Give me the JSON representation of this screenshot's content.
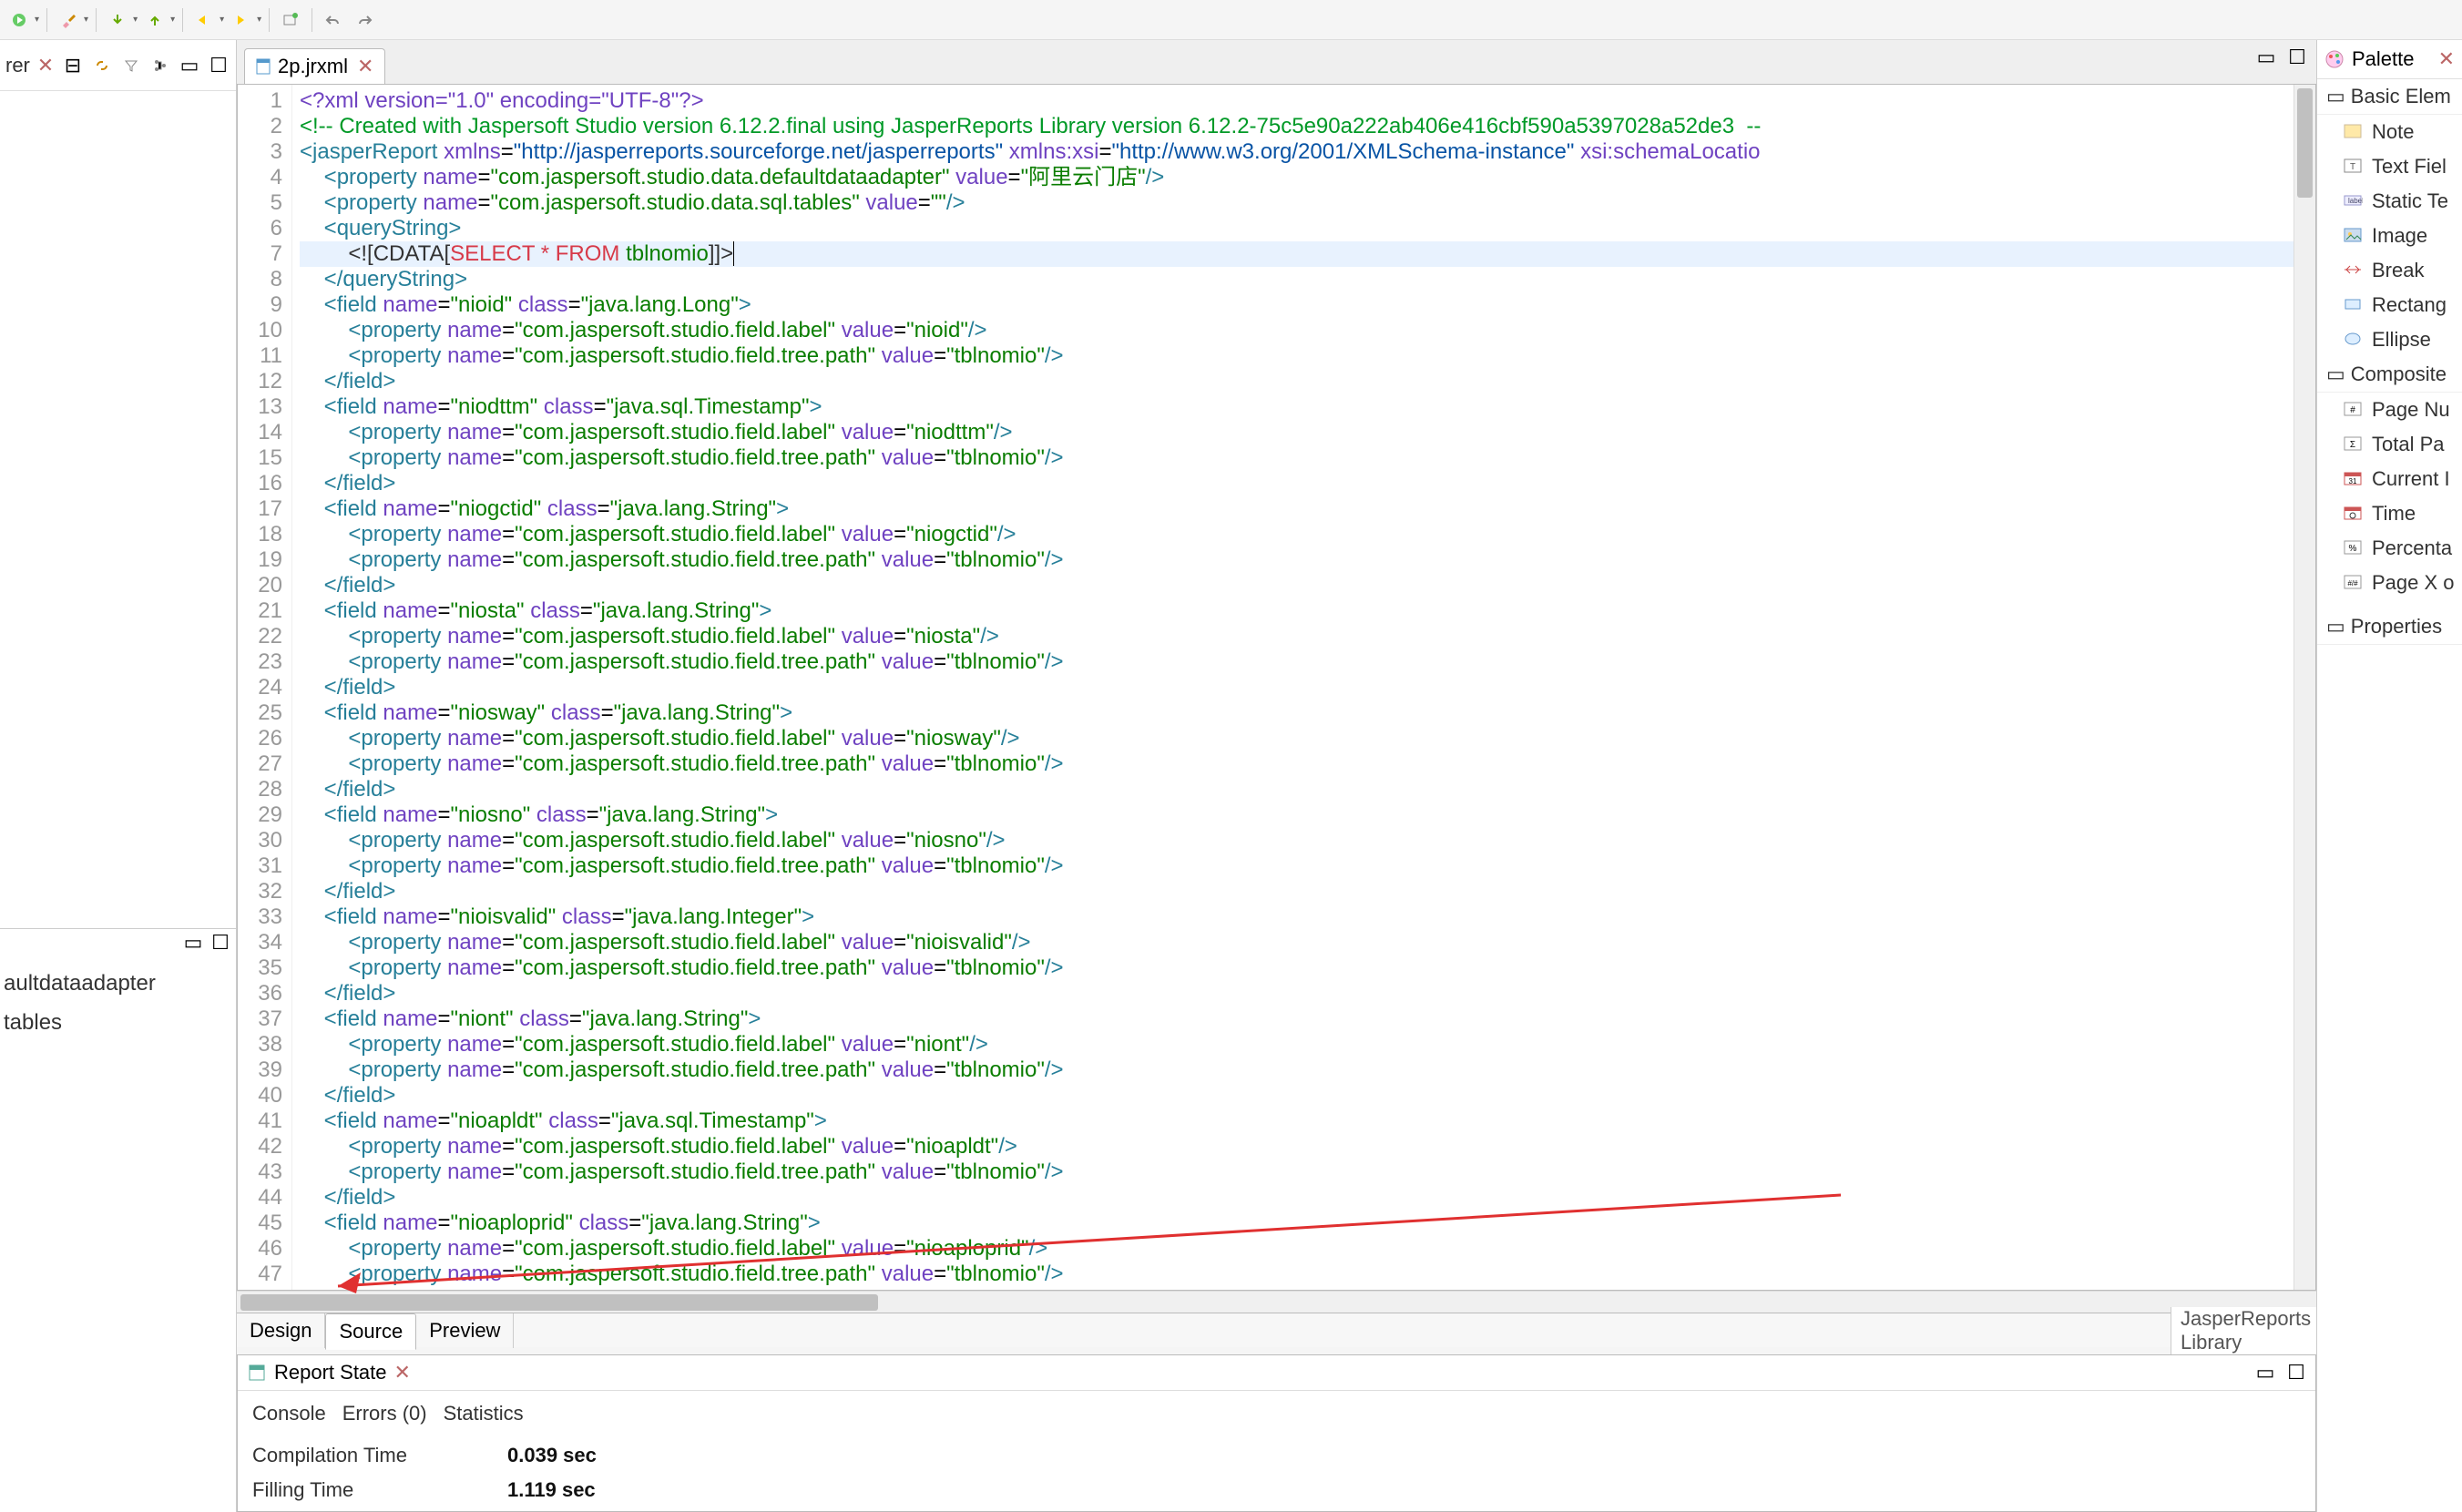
{
  "toolbar": {
    "icons": [
      "run",
      "brush",
      "arrow-down-g",
      "arrow-up-g",
      "back",
      "forward",
      "new-window",
      "refresh-l",
      "refresh-r"
    ]
  },
  "left": {
    "explorer_tab": "rer"
  },
  "left_bottom": {
    "items": [
      "aultdataadapter",
      "tables"
    ]
  },
  "editor": {
    "tab_name": "2p.jrxml",
    "code": [
      {
        "n": 1,
        "html": "<span class='t-pi'>&lt;?xml version=\"1.0\" encoding=\"UTF-8\"?&gt;</span>"
      },
      {
        "n": 2,
        "html": "<span class='t-cm'>&lt;!-- Created with Jaspersoft Studio version 6.12.2.final using JasperReports Library version 6.12.2-75c5e90a222ab406e416cbf590a5397028a52de3  --</span>"
      },
      {
        "n": 3,
        "html": "<span class='t-tag'>&lt;jasperReport</span> <span class='t-attr'>xmlns</span>=<span class='t-url'>\"http://jasperreports.sourceforge.net/jasperreports\"</span> <span class='t-attr'>xmlns:xsi</span>=<span class='t-url'>\"http://www.w3.org/2001/XMLSchema-instance\"</span> <span class='t-attr'>xsi:schemaLocatio</span>"
      },
      {
        "n": 4,
        "html": "    <span class='t-tag'>&lt;property</span> <span class='t-attr'>name</span>=<span class='t-str'>\"com.jaspersoft.studio.data.defaultdataadapter\"</span> <span class='t-attr'>value</span>=<span class='t-str'>\"阿里云门店\"</span><span class='t-tag'>/&gt;</span>"
      },
      {
        "n": 5,
        "html": "    <span class='t-tag'>&lt;property</span> <span class='t-attr'>name</span>=<span class='t-str'>\"com.jaspersoft.studio.data.sql.tables\"</span> <span class='t-attr'>value</span>=<span class='t-str'>\"\"</span><span class='t-tag'>/&gt;</span>"
      },
      {
        "n": 6,
        "html": "    <span class='t-tag'>&lt;queryString&gt;</span>"
      },
      {
        "n": 7,
        "hl": true,
        "html": "        <span class='t-sym'>&lt;![CDATA[</span><span class='t-kw'>SELECT</span> <span class='t-kw'>*</span> <span class='t-kw'>FROM</span> <span class='t-str'>tblnomio</span><span class='t-sym'>]]&gt;</span><span class='cursor'></span>"
      },
      {
        "n": 8,
        "html": "    <span class='t-tag'>&lt;/queryString&gt;</span>"
      },
      {
        "n": 9,
        "html": "    <span class='t-tag'>&lt;field</span> <span class='t-attr'>name</span>=<span class='t-str'>\"nioid\"</span> <span class='t-attr'>class</span>=<span class='t-str'>\"java.lang.Long\"</span><span class='t-tag'>&gt;</span>"
      },
      {
        "n": 10,
        "html": "        <span class='t-tag'>&lt;property</span> <span class='t-attr'>name</span>=<span class='t-str'>\"com.jaspersoft.studio.field.label\"</span> <span class='t-attr'>value</span>=<span class='t-str'>\"nioid\"</span><span class='t-tag'>/&gt;</span>"
      },
      {
        "n": 11,
        "html": "        <span class='t-tag'>&lt;property</span> <span class='t-attr'>name</span>=<span class='t-str'>\"com.jaspersoft.studio.field.tree.path\"</span> <span class='t-attr'>value</span>=<span class='t-str'>\"tblnomio\"</span><span class='t-tag'>/&gt;</span>"
      },
      {
        "n": 12,
        "html": "    <span class='t-tag'>&lt;/field&gt;</span>"
      },
      {
        "n": 13,
        "html": "    <span class='t-tag'>&lt;field</span> <span class='t-attr'>name</span>=<span class='t-str'>\"niodttm\"</span> <span class='t-attr'>class</span>=<span class='t-str'>\"java.sql.Timestamp\"</span><span class='t-tag'>&gt;</span>"
      },
      {
        "n": 14,
        "html": "        <span class='t-tag'>&lt;property</span> <span class='t-attr'>name</span>=<span class='t-str'>\"com.jaspersoft.studio.field.label\"</span> <span class='t-attr'>value</span>=<span class='t-str'>\"niodttm\"</span><span class='t-tag'>/&gt;</span>"
      },
      {
        "n": 15,
        "html": "        <span class='t-tag'>&lt;property</span> <span class='t-attr'>name</span>=<span class='t-str'>\"com.jaspersoft.studio.field.tree.path\"</span> <span class='t-attr'>value</span>=<span class='t-str'>\"tblnomio\"</span><span class='t-tag'>/&gt;</span>"
      },
      {
        "n": 16,
        "html": "    <span class='t-tag'>&lt;/field&gt;</span>"
      },
      {
        "n": 17,
        "html": "    <span class='t-tag'>&lt;field</span> <span class='t-attr'>name</span>=<span class='t-str'>\"niogctid\"</span> <span class='t-attr'>class</span>=<span class='t-str'>\"java.lang.String\"</span><span class='t-tag'>&gt;</span>"
      },
      {
        "n": 18,
        "html": "        <span class='t-tag'>&lt;property</span> <span class='t-attr'>name</span>=<span class='t-str'>\"com.jaspersoft.studio.field.label\"</span> <span class='t-attr'>value</span>=<span class='t-str'>\"niogctid\"</span><span class='t-tag'>/&gt;</span>"
      },
      {
        "n": 19,
        "html": "        <span class='t-tag'>&lt;property</span> <span class='t-attr'>name</span>=<span class='t-str'>\"com.jaspersoft.studio.field.tree.path\"</span> <span class='t-attr'>value</span>=<span class='t-str'>\"tblnomio\"</span><span class='t-tag'>/&gt;</span>"
      },
      {
        "n": 20,
        "html": "    <span class='t-tag'>&lt;/field&gt;</span>"
      },
      {
        "n": 21,
        "html": "    <span class='t-tag'>&lt;field</span> <span class='t-attr'>name</span>=<span class='t-str'>\"niosta\"</span> <span class='t-attr'>class</span>=<span class='t-str'>\"java.lang.String\"</span><span class='t-tag'>&gt;</span>"
      },
      {
        "n": 22,
        "html": "        <span class='t-tag'>&lt;property</span> <span class='t-attr'>name</span>=<span class='t-str'>\"com.jaspersoft.studio.field.label\"</span> <span class='t-attr'>value</span>=<span class='t-str'>\"niosta\"</span><span class='t-tag'>/&gt;</span>"
      },
      {
        "n": 23,
        "html": "        <span class='t-tag'>&lt;property</span> <span class='t-attr'>name</span>=<span class='t-str'>\"com.jaspersoft.studio.field.tree.path\"</span> <span class='t-attr'>value</span>=<span class='t-str'>\"tblnomio\"</span><span class='t-tag'>/&gt;</span>"
      },
      {
        "n": 24,
        "html": "    <span class='t-tag'>&lt;/field&gt;</span>"
      },
      {
        "n": 25,
        "html": "    <span class='t-tag'>&lt;field</span> <span class='t-attr'>name</span>=<span class='t-str'>\"niosway\"</span> <span class='t-attr'>class</span>=<span class='t-str'>\"java.lang.String\"</span><span class='t-tag'>&gt;</span>"
      },
      {
        "n": 26,
        "html": "        <span class='t-tag'>&lt;property</span> <span class='t-attr'>name</span>=<span class='t-str'>\"com.jaspersoft.studio.field.label\"</span> <span class='t-attr'>value</span>=<span class='t-str'>\"niosway\"</span><span class='t-tag'>/&gt;</span>"
      },
      {
        "n": 27,
        "html": "        <span class='t-tag'>&lt;property</span> <span class='t-attr'>name</span>=<span class='t-str'>\"com.jaspersoft.studio.field.tree.path\"</span> <span class='t-attr'>value</span>=<span class='t-str'>\"tblnomio\"</span><span class='t-tag'>/&gt;</span>"
      },
      {
        "n": 28,
        "html": "    <span class='t-tag'>&lt;/field&gt;</span>"
      },
      {
        "n": 29,
        "html": "    <span class='t-tag'>&lt;field</span> <span class='t-attr'>name</span>=<span class='t-str'>\"niosno\"</span> <span class='t-attr'>class</span>=<span class='t-str'>\"java.lang.String\"</span><span class='t-tag'>&gt;</span>"
      },
      {
        "n": 30,
        "html": "        <span class='t-tag'>&lt;property</span> <span class='t-attr'>name</span>=<span class='t-str'>\"com.jaspersoft.studio.field.label\"</span> <span class='t-attr'>value</span>=<span class='t-str'>\"niosno\"</span><span class='t-tag'>/&gt;</span>"
      },
      {
        "n": 31,
        "html": "        <span class='t-tag'>&lt;property</span> <span class='t-attr'>name</span>=<span class='t-str'>\"com.jaspersoft.studio.field.tree.path\"</span> <span class='t-attr'>value</span>=<span class='t-str'>\"tblnomio\"</span><span class='t-tag'>/&gt;</span>"
      },
      {
        "n": 32,
        "html": "    <span class='t-tag'>&lt;/field&gt;</span>"
      },
      {
        "n": 33,
        "html": "    <span class='t-tag'>&lt;field</span> <span class='t-attr'>name</span>=<span class='t-str'>\"nioisvalid\"</span> <span class='t-attr'>class</span>=<span class='t-str'>\"java.lang.Integer\"</span><span class='t-tag'>&gt;</span>"
      },
      {
        "n": 34,
        "html": "        <span class='t-tag'>&lt;property</span> <span class='t-attr'>name</span>=<span class='t-str'>\"com.jaspersoft.studio.field.label\"</span> <span class='t-attr'>value</span>=<span class='t-str'>\"nioisvalid\"</span><span class='t-tag'>/&gt;</span>"
      },
      {
        "n": 35,
        "html": "        <span class='t-tag'>&lt;property</span> <span class='t-attr'>name</span>=<span class='t-str'>\"com.jaspersoft.studio.field.tree.path\"</span> <span class='t-attr'>value</span>=<span class='t-str'>\"tblnomio\"</span><span class='t-tag'>/&gt;</span>"
      },
      {
        "n": 36,
        "html": "    <span class='t-tag'>&lt;/field&gt;</span>"
      },
      {
        "n": 37,
        "html": "    <span class='t-tag'>&lt;field</span> <span class='t-attr'>name</span>=<span class='t-str'>\"niont\"</span> <span class='t-attr'>class</span>=<span class='t-str'>\"java.lang.String\"</span><span class='t-tag'>&gt;</span>"
      },
      {
        "n": 38,
        "html": "        <span class='t-tag'>&lt;property</span> <span class='t-attr'>name</span>=<span class='t-str'>\"com.jaspersoft.studio.field.label\"</span> <span class='t-attr'>value</span>=<span class='t-str'>\"niont\"</span><span class='t-tag'>/&gt;</span>"
      },
      {
        "n": 39,
        "html": "        <span class='t-tag'>&lt;property</span> <span class='t-attr'>name</span>=<span class='t-str'>\"com.jaspersoft.studio.field.tree.path\"</span> <span class='t-attr'>value</span>=<span class='t-str'>\"tblnomio\"</span><span class='t-tag'>/&gt;</span>"
      },
      {
        "n": 40,
        "html": "    <span class='t-tag'>&lt;/field&gt;</span>"
      },
      {
        "n": 41,
        "html": "    <span class='t-tag'>&lt;field</span> <span class='t-attr'>name</span>=<span class='t-str'>\"nioapldt\"</span> <span class='t-attr'>class</span>=<span class='t-str'>\"java.sql.Timestamp\"</span><span class='t-tag'>&gt;</span>"
      },
      {
        "n": 42,
        "html": "        <span class='t-tag'>&lt;property</span> <span class='t-attr'>name</span>=<span class='t-str'>\"com.jaspersoft.studio.field.label\"</span> <span class='t-attr'>value</span>=<span class='t-str'>\"nioapldt\"</span><span class='t-tag'>/&gt;</span>"
      },
      {
        "n": 43,
        "html": "        <span class='t-tag'>&lt;property</span> <span class='t-attr'>name</span>=<span class='t-str'>\"com.jaspersoft.studio.field.tree.path\"</span> <span class='t-attr'>value</span>=<span class='t-str'>\"tblnomio\"</span><span class='t-tag'>/&gt;</span>"
      },
      {
        "n": 44,
        "html": "    <span class='t-tag'>&lt;/field&gt;</span>"
      },
      {
        "n": 45,
        "html": "    <span class='t-tag'>&lt;field</span> <span class='t-attr'>name</span>=<span class='t-str'>\"nioaploprid\"</span> <span class='t-attr'>class</span>=<span class='t-str'>\"java.lang.String\"</span><span class='t-tag'>&gt;</span>"
      },
      {
        "n": 46,
        "html": "        <span class='t-tag'>&lt;property</span> <span class='t-attr'>name</span>=<span class='t-str'>\"com.jaspersoft.studio.field.label\"</span> <span class='t-attr'>value</span>=<span class='t-str'>\"nioaploprid\"</span><span class='t-tag'>/&gt;</span>"
      },
      {
        "n": 47,
        "html": "        <span class='t-tag'>&lt;property</span> <span class='t-attr'>name</span>=<span class='t-str'>\"com.jaspersoft.studio.field.tree.path\"</span> <span class='t-attr'>value</span>=<span class='t-str'>\"tblnomio\"</span><span class='t-tag'>/&gt;</span>"
      }
    ],
    "bottom_tabs": [
      "Design",
      "Source",
      "Preview"
    ],
    "footer_right": "JasperReports Library"
  },
  "report_state": {
    "tab": "Report State",
    "subtabs": [
      "Console",
      "Errors (0)",
      "Statistics"
    ],
    "rows": [
      {
        "k": "Compilation Time",
        "v": "0.039 sec"
      },
      {
        "k": "Filling Time",
        "v": "1.119 sec"
      }
    ]
  },
  "palette": {
    "title": "Palette",
    "groups": [
      {
        "name": "Basic Elem",
        "items": [
          {
            "icon": "note",
            "label": "Note"
          },
          {
            "icon": "text",
            "label": "Text Fiel"
          },
          {
            "icon": "static",
            "label": "Static Te"
          },
          {
            "icon": "image",
            "label": "Image"
          },
          {
            "icon": "break",
            "label": "Break"
          },
          {
            "icon": "rect",
            "label": "Rectang"
          },
          {
            "icon": "ellipse",
            "label": "Ellipse"
          }
        ]
      },
      {
        "name": "Composite",
        "items": [
          {
            "icon": "pagenum",
            "label": "Page Nu"
          },
          {
            "icon": "total",
            "label": "Total Pa"
          },
          {
            "icon": "date",
            "label": "Current I"
          },
          {
            "icon": "time",
            "label": "Time"
          },
          {
            "icon": "percent",
            "label": "Percenta"
          },
          {
            "icon": "pagex",
            "label": "Page X o"
          }
        ]
      }
    ],
    "properties": "Properties"
  }
}
